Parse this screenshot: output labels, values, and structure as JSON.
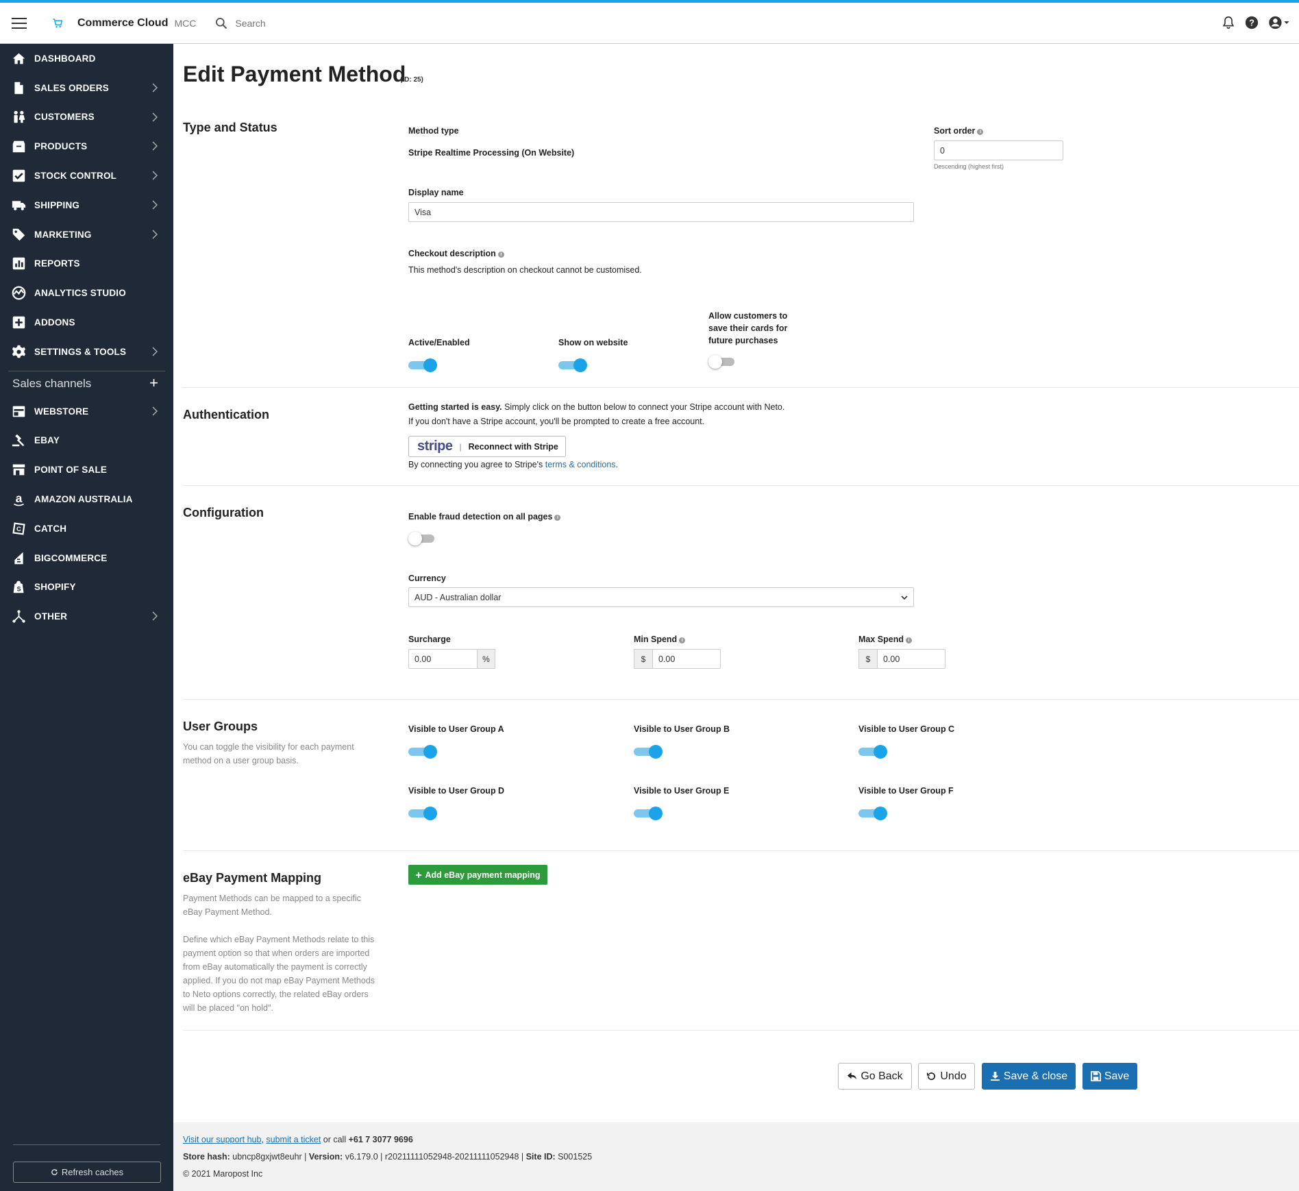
{
  "header": {
    "brand": "Commerce Cloud",
    "brand_sub": "MCC",
    "search_placeholder": "Search"
  },
  "sidebar": {
    "items": [
      {
        "label": "DASHBOARD",
        "icon": "home-icon"
      },
      {
        "label": "SALES ORDERS",
        "icon": "document-icon"
      },
      {
        "label": "CUSTOMERS",
        "icon": "people-icon"
      },
      {
        "label": "PRODUCTS",
        "icon": "box-icon"
      },
      {
        "label": "STOCK CONTROL",
        "icon": "checkbox-icon"
      },
      {
        "label": "SHIPPING",
        "icon": "truck-icon"
      },
      {
        "label": "MARKETING",
        "icon": "tag-icon"
      },
      {
        "label": "REPORTS",
        "icon": "bar-chart-icon"
      },
      {
        "label": "ANALYTICS STUDIO",
        "icon": "analytics-icon"
      },
      {
        "label": "ADDONS",
        "icon": "plus-square-icon"
      },
      {
        "label": "SETTINGS & TOOLS",
        "icon": "gear-icon"
      }
    ],
    "sales_channels_label": "Sales channels",
    "channels": [
      {
        "label": "WEBSTORE",
        "icon": "webstore-icon"
      },
      {
        "label": "EBAY",
        "icon": "gavel-icon"
      },
      {
        "label": "POINT OF SALE",
        "icon": "store-icon"
      },
      {
        "label": "AMAZON AUSTRALIA",
        "icon": "amazon-icon"
      },
      {
        "label": "CATCH",
        "icon": "catch-icon"
      },
      {
        "label": "BIGCOMMERCE",
        "icon": "bigcommerce-icon"
      },
      {
        "label": "SHOPIFY",
        "icon": "shopify-icon"
      },
      {
        "label": "OTHER",
        "icon": "network-icon"
      }
    ],
    "refresh_label": "Refresh caches"
  },
  "page": {
    "title": "Edit Payment Method",
    "id_label": "(ID: 25)"
  },
  "type_status": {
    "section_title": "Type and Status",
    "method_type_label": "Method type",
    "method_type_value": "Stripe Realtime Processing (On Website)",
    "sort_order_label": "Sort order",
    "sort_order_value": "0",
    "sort_order_note": "Descending (highest first)",
    "display_name_label": "Display name",
    "display_name_value": "Visa",
    "checkout_desc_label": "Checkout description",
    "checkout_desc_text": "This method's description on checkout cannot be customised.",
    "active_label": "Active/Enabled",
    "active_on": true,
    "show_website_label": "Show on website",
    "show_website_on": true,
    "save_cards_label_1": "Allow customers to",
    "save_cards_label_2": "save their cards for",
    "save_cards_label_3": "future purchases",
    "save_cards_on": false
  },
  "authentication": {
    "section_title": "Authentication",
    "intro_bold": "Getting started is easy.",
    "intro_rest": " Simply click on the button below to connect your Stripe account with Neto.",
    "intro_line2": "If you don't have a Stripe account, you'll be prompted to create a free account.",
    "stripe_logo": "stripe",
    "stripe_button": "Reconnect with Stripe",
    "agree_text": "By connecting you agree to Stripe's ",
    "agree_link": "terms & conditions",
    "agree_end": "."
  },
  "configuration": {
    "section_title": "Configuration",
    "fraud_label": "Enable fraud detection on all pages",
    "fraud_on": false,
    "currency_label": "Currency",
    "currency_value": "AUD - Australian dollar",
    "surcharge_label": "Surcharge",
    "surcharge_value": "0.00",
    "surcharge_unit": "%",
    "min_spend_label": "Min Spend",
    "min_spend_value": "0.00",
    "max_spend_label": "Max Spend",
    "max_spend_value": "0.00",
    "currency_symbol": "$"
  },
  "user_groups": {
    "section_title": "User Groups",
    "desc_1": "You can toggle the visibility for each payment",
    "desc_2": "method on a user group basis.",
    "groups": [
      {
        "label": "Visible to User Group A",
        "on": true
      },
      {
        "label": "Visible to User Group B",
        "on": true
      },
      {
        "label": "Visible to User Group C",
        "on": true
      },
      {
        "label": "Visible to User Group D",
        "on": true
      },
      {
        "label": "Visible to User Group E",
        "on": true
      },
      {
        "label": "Visible to User Group F",
        "on": true
      }
    ]
  },
  "ebay": {
    "section_title": "eBay Payment Mapping",
    "add_button": "Add eBay payment mapping",
    "desc_1": "Payment Methods can be mapped to a specific",
    "desc_2": "eBay Payment Method.",
    "desc_3": "Define which eBay Payment Methods relate to this",
    "desc_4": "payment option so that when orders are imported",
    "desc_5": "from eBay automatically the payment is correctly",
    "desc_6": "applied. If you do not map eBay Payment Methods",
    "desc_7": "to Neto options correctly, the related eBay orders",
    "desc_8": "will be placed \"on hold\"."
  },
  "actions": {
    "go_back": "Go Back",
    "undo": "Undo",
    "save_close": "Save & close",
    "save": "Save"
  },
  "footer": {
    "support_link": "Visit our support hub",
    "sep": ", ",
    "ticket_link": "submit a ticket",
    "call_text": " or call ",
    "phone": "+61 7 3077 9696",
    "store_hash_label": "Store hash:",
    "store_hash_value": " ubncp8gxjwt8euhr | ",
    "version_label": "Version:",
    "version_value": " v6.179.0 | r20211111052948-20211111052948 | ",
    "site_id_label": "Site ID:",
    "site_id_value": " S001525",
    "copyright": "© 2021 Maropost Inc"
  },
  "colors": {
    "accent": "#1aa3e8",
    "sidebar_bg": "#1f2937",
    "primary_button": "#1a6fb3",
    "success_button": "#2d9b3c"
  }
}
